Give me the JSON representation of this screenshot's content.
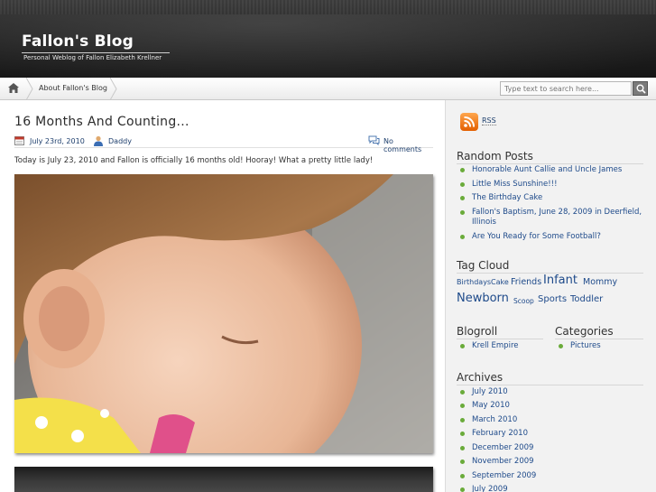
{
  "header": {
    "title": "Fallon's Blog",
    "description": "Personal Weblog of Fallon Elizabeth Krellner"
  },
  "nav": {
    "home_icon": "home-icon",
    "about_label": "About Fallon's Blog",
    "search_placeholder": "Type text to search here..."
  },
  "post": {
    "title": "16 Months And Counting...",
    "date": "July 23rd, 2010",
    "author": "Daddy",
    "comments": "No comments",
    "body": "Today is July 23, 2010 and Fallon is officially 16 months old!  Hooray!  What a pretty little lady!"
  },
  "sidebar": {
    "rss_label": "RSS",
    "random_posts": {
      "title": "Random Posts",
      "items": [
        "Honorable Aunt Callie and Uncle James",
        "Little Miss Sunshine!!!",
        "The Birthday Cake",
        "Fallon's Baptism, June 28, 2009 in Deerfield,",
        "Illinois",
        "Are You Ready for Some Football?"
      ]
    },
    "tag_cloud": {
      "title": "Tag Cloud",
      "tags": [
        "Birthdays",
        "Cake",
        "Friends",
        "Infant",
        "Mommy",
        "Newborn",
        "Scoop",
        "Sports",
        "Toddler"
      ]
    },
    "blogroll": {
      "title": "Blogroll",
      "items": [
        "Krell Empire"
      ]
    },
    "categories": {
      "title": "Categories",
      "items": [
        "Pictures"
      ]
    },
    "archives": {
      "title": "Archives",
      "items": [
        "July 2010",
        "May 2010",
        "March 2010",
        "February 2010",
        "December 2009",
        "November 2009",
        "September 2009",
        "July 2009"
      ]
    }
  },
  "colors": {
    "link": "#1e4a8a",
    "bullet": "#6aab3a",
    "header_bg": "#1a1a1a",
    "sidebar_bg": "#f2f2f2"
  }
}
